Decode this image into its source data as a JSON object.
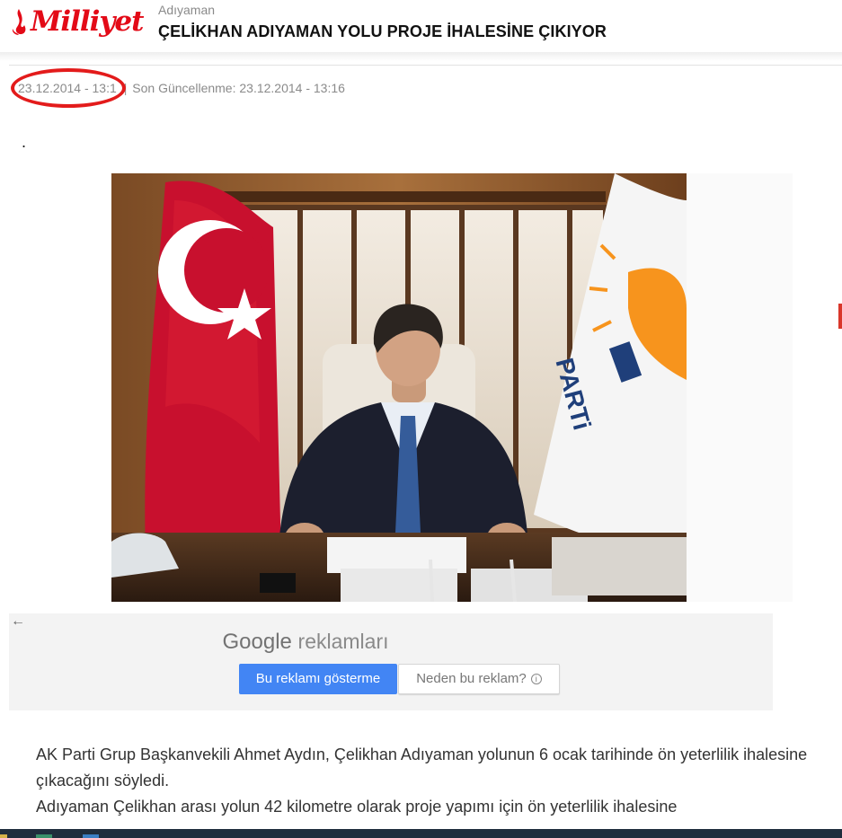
{
  "header": {
    "logo_text": "Milliyet",
    "section": "Adıyaman",
    "title": "ÇELİKHAN ADIYAMAN YOLU PROJE İHALESİNE ÇIKIYOR"
  },
  "meta": {
    "published": "23.12.2014 - 13:1",
    "separator": "|",
    "updated": "Son Güncellenme: 23.12.2014 - 13:16"
  },
  "lead_marker": ".",
  "ad": {
    "back_icon": "arrow-left-icon",
    "brand": "Google",
    "brand_suffix": "reklamları",
    "hide_button": "Bu reklamı gösterme",
    "why_button": "Neden bu reklam?",
    "info_icon": "info-icon"
  },
  "article": {
    "paragraph_1": "AK Parti Grup Başkanvekili Ahmet Aydın, Çelikhan Adıyaman yolunun 6 ocak tarihinde ön yeterlilik ihalesine çıkacağını söyledi.",
    "paragraph_2": "Adıyaman Çelikhan arası yolun 42 kilometre olarak proje yapımı için ön yeterlilik ihalesine"
  },
  "colors": {
    "brand_red": "#e30a17",
    "annotation_red": "#e31b1b",
    "google_blue": "#4285f4"
  }
}
